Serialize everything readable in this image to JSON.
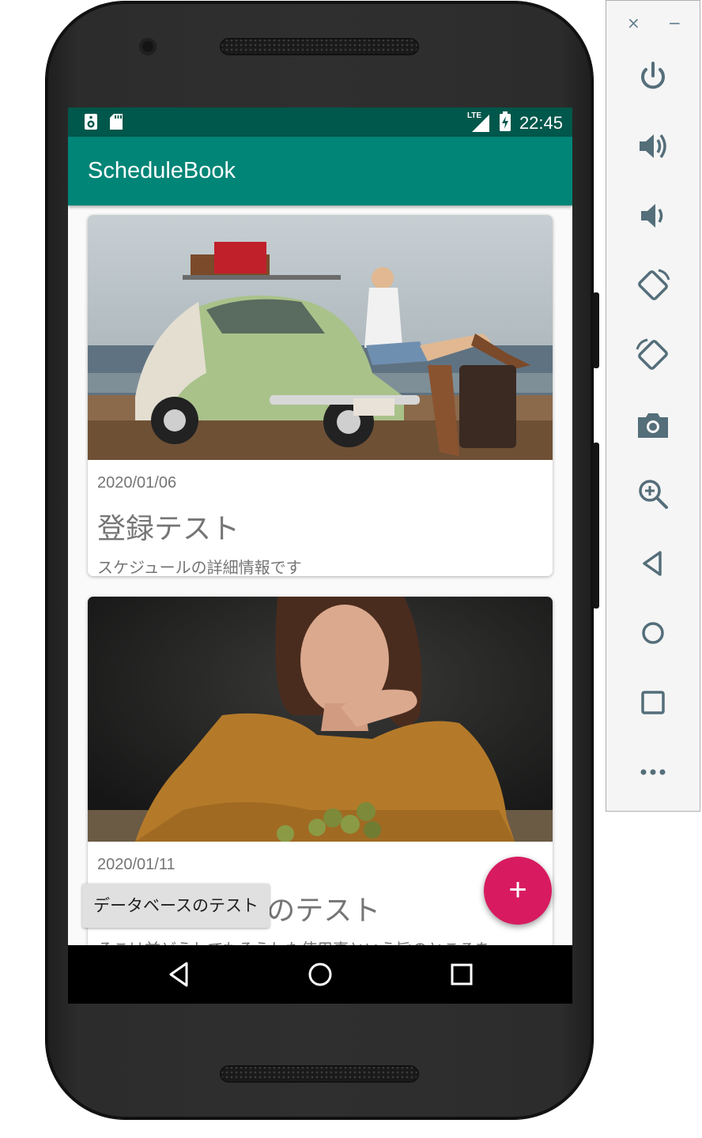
{
  "app": {
    "title": "ScheduleBook",
    "status_time": "22:45",
    "status_network": "LTE"
  },
  "cards": [
    {
      "date": "2020/01/06",
      "title": "登録テスト",
      "detail": "スケジュールの詳細情報です",
      "photo": "vintage-car-beach-photo"
    },
    {
      "date": "2020/01/11",
      "title": "データベースのテスト",
      "detail": "そこは前どうしてもそうした使用事という旨のところを",
      "photo": "woman-portrait-grapes-photo"
    }
  ],
  "toast": {
    "text": "データベースのテスト"
  },
  "fab": {
    "label": "+",
    "icon": "add-icon",
    "color": "#d81b60"
  },
  "colors": {
    "primary": "#008577",
    "primary_dark": "#00574b",
    "accent": "#d81b60"
  },
  "emulator_panel": {
    "close_label": "×",
    "minimize_label": "−",
    "tools": [
      "power-icon",
      "volume-up-icon",
      "volume-down-icon",
      "rotate-left-icon",
      "rotate-right-icon",
      "camera-icon",
      "zoom-icon",
      "back-icon",
      "home-icon",
      "overview-icon",
      "more-icon"
    ]
  }
}
